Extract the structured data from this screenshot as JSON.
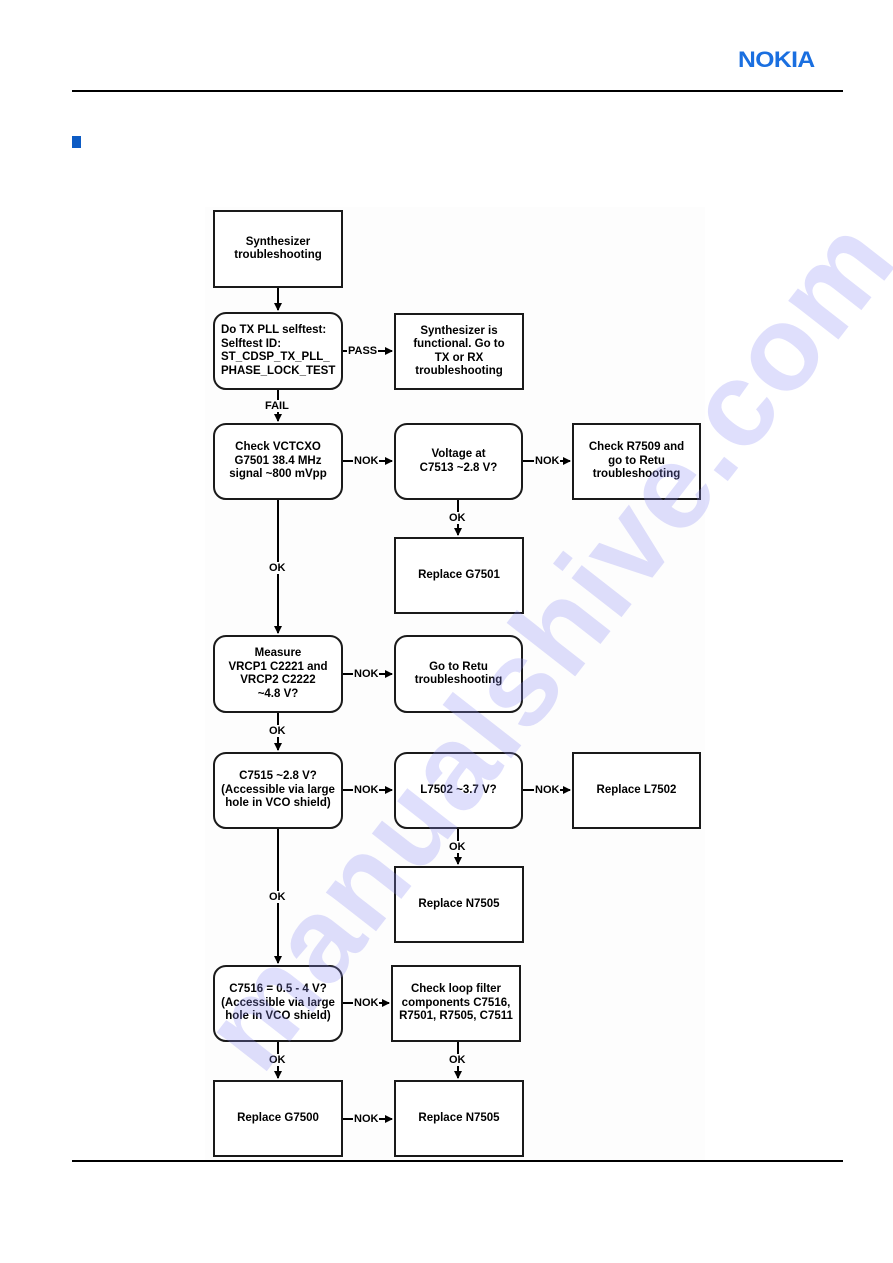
{
  "header": {
    "logo_text": "NOKIA",
    "brand_color": "#1a6fe0",
    "bullet_color": "#0d5bc4"
  },
  "watermark": "manualshive.com",
  "flowchart": {
    "nodes": {
      "start": "Synthesizer\ntroubleshooting",
      "selftest": "Do TX PLL selftest:\nSelftest ID:\nST_CDSP_TX_PLL_\nPHASE_LOCK_TEST",
      "functional": "Synthesizer is\nfunctional. Go to\nTX or RX\ntroubleshooting",
      "vctcxo": "Check VCTCXO\nG7501 38.4 MHz\nsignal ~800 mVpp",
      "voltage_c7513": "Voltage at\nC7513 ~2.8 V?",
      "check_r7509": "Check R7509 and\ngo to Retu\ntroubleshooting",
      "replace_g7501": "Replace G7501",
      "measure_vrcp": "Measure\nVRCP1 C2221 and\nVRCP2 C2222\n~4.8 V?",
      "goto_retu": "Go to Retu\ntroubleshooting",
      "c7515": "C7515 ~2.8 V?\n(Accessible via large\nhole in VCO shield)",
      "l7502": "L7502 ~3.7 V?",
      "replace_l7502": "Replace L7502",
      "replace_n7505_a": "Replace N7505",
      "c7516": "C7516 = 0.5 - 4 V?\n(Accessible via large\nhole in VCO shield)",
      "loop_filter": "Check loop filter\ncomponents C7516,\nR7501, R7505, C7511",
      "replace_g7500": "Replace G7500",
      "replace_n7505_b": "Replace N7505"
    },
    "edge_labels": {
      "pass": "PASS",
      "fail": "FAIL",
      "nok": "NOK",
      "ok": "OK"
    }
  }
}
